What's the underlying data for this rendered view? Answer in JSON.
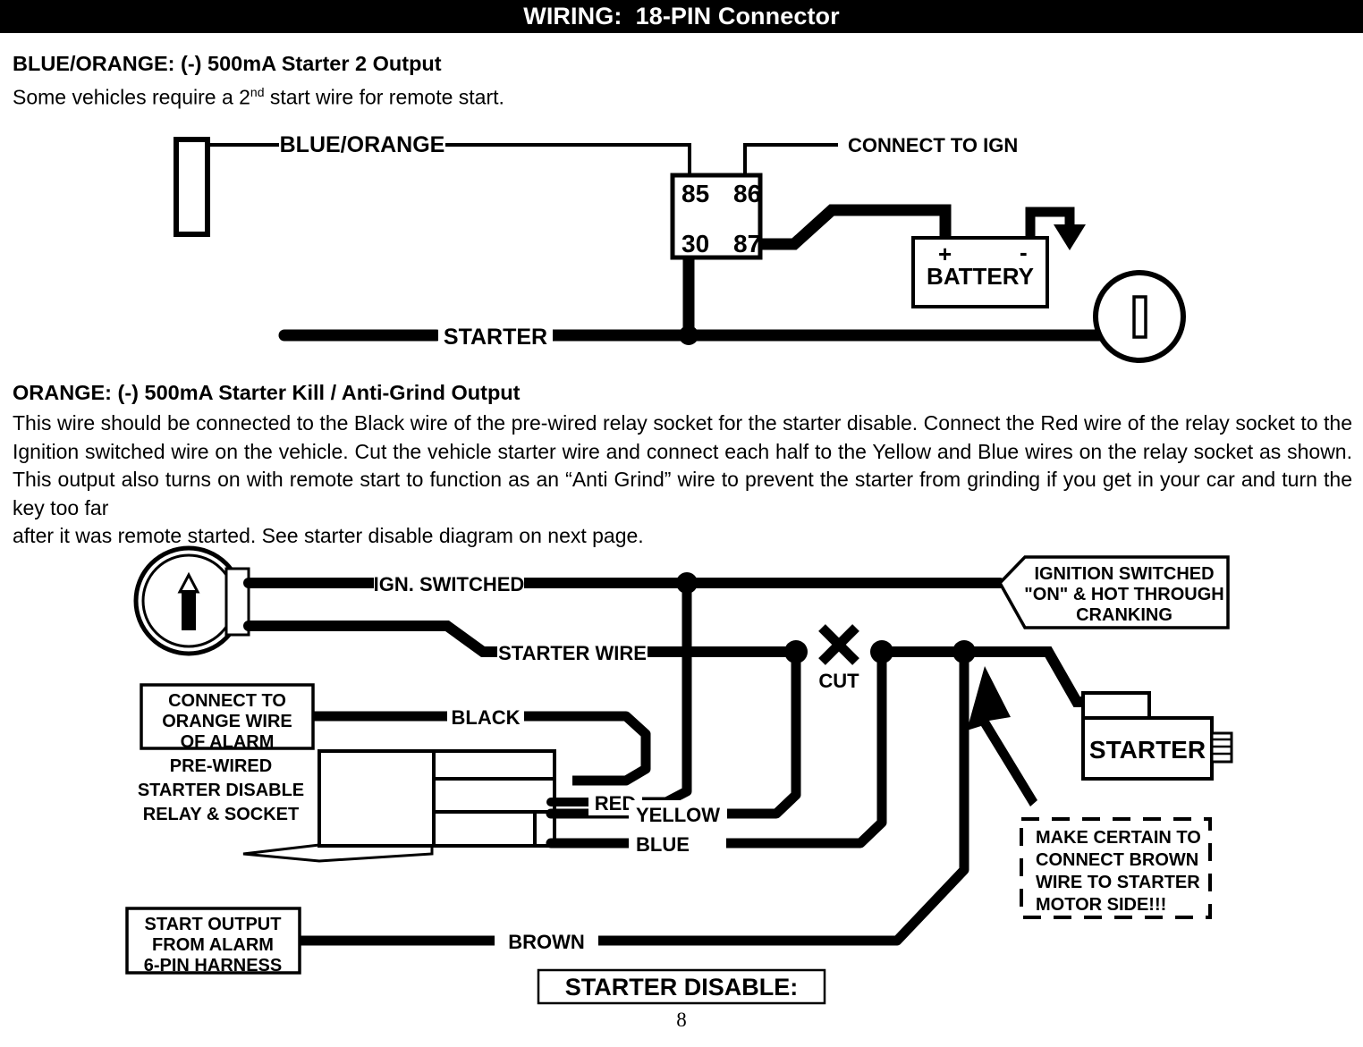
{
  "header": {
    "title": "WIRING:  18-PIN Connector"
  },
  "sections": [
    {
      "heading": "BLUE/ORANGE: (-) 500mA Starter 2 Output",
      "subtitle_before": "Some vehicles require a 2",
      "subtitle_sup": "nd",
      "subtitle_after": " start wire for remote start."
    },
    {
      "heading": "ORANGE: (-) 500mA Starter Kill / Anti-Grind Output",
      "body": "This wire should be connected to the Black wire of the pre-wired relay socket for the starter disable. Connect the Red wire of the relay socket to the Ignition switched wire on the vehicle. Cut the vehicle starter wire and connect each half to the Yellow and Blue wires on the relay socket as shown. This output also turns on with remote start to function as an “Anti Grind” wire to prevent the starter from grinding if you get in your car and turn the key too far",
      "body_last": "after it was remote started.  See starter disable diagram on next page."
    }
  ],
  "diagram1": {
    "wire_blue_orange": "BLUE/ORANGE",
    "connect_to_ign": "CONNECT TO  IGN",
    "relay_pin_85": "85",
    "relay_pin_86": "86",
    "relay_pin_30": "30",
    "relay_pin_87": "87",
    "battery_plus": "+",
    "battery_minus": "-",
    "battery_label": "BATTERY",
    "starter_label": "STARTER"
  },
  "diagram2": {
    "ign_switched": "IGN. SWITCHED",
    "starter_wire": "STARTER WIRE",
    "cut_label": "CUT",
    "black_wire": "BLACK",
    "red_wire": "RED",
    "yellow_wire": "YELLOW",
    "blue_wire": "BLUE",
    "brown_wire": "BROWN",
    "callout_connect_orange": [
      "CONNECT TO",
      "ORANGE WIRE",
      "OF ALARM"
    ],
    "callout_prewired": [
      "PRE-WIRED",
      "STARTER DISABLE",
      "RELAY & SOCKET"
    ],
    "callout_start_output": [
      "START OUTPUT",
      "FROM ALARM",
      "6-PIN HARNESS"
    ],
    "callout_ignition_switched": [
      "IGNITION SWITCHED",
      "\"ON\" & HOT THROUGH",
      "CRANKING"
    ],
    "callout_make_certain": [
      "MAKE CERTAIN TO",
      "CONNECT BROWN",
      "WIRE TO STARTER",
      "MOTOR SIDE!!!"
    ],
    "starter_box_label": "STARTER",
    "title_box": "STARTER DISABLE:"
  },
  "footer": {
    "page_number": "8"
  },
  "colors": {
    "ink": "#000000",
    "paper": "#ffffff",
    "header_bg": "#000000",
    "header_fg": "#ffffff"
  }
}
